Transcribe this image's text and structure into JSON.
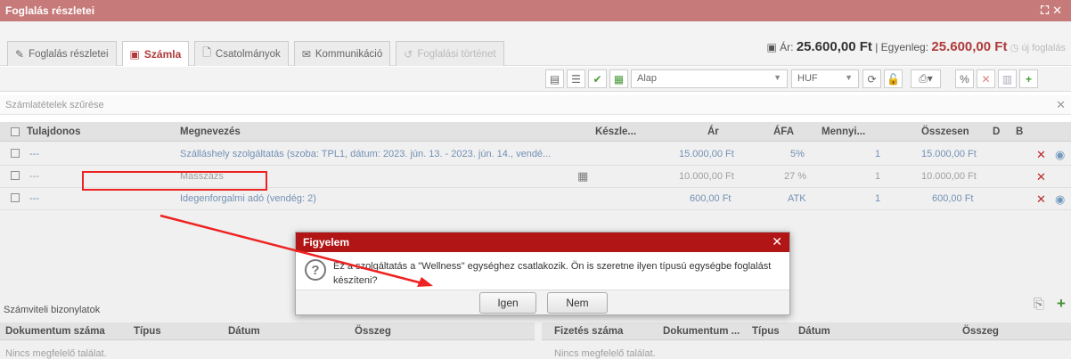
{
  "window": {
    "title": "Foglalás részletei"
  },
  "tabs": [
    {
      "label": "Foglalás részletei",
      "icon": "pencil-icon"
    },
    {
      "label": "Számla",
      "icon": "invoice-icon"
    },
    {
      "label": "Csatolmányok",
      "icon": "file-icon"
    },
    {
      "label": "Kommunikáció",
      "icon": "envelope-icon"
    },
    {
      "label": "Foglalási történet",
      "icon": "history-icon"
    }
  ],
  "price_info": {
    "price_label": "Ár:",
    "price": "25.600,00 Ft",
    "balance_label": "| Egyenleg:",
    "balance": "25.600,00 Ft",
    "new_booking": "új foglalás"
  },
  "toolbar": {
    "template": "Alap",
    "currency": "HUF"
  },
  "filter": {
    "placeholder": "Számlatételek szűrése"
  },
  "table": {
    "columns": [
      "Tulajdonos",
      "Megnevezés",
      "Készle...",
      "Ár",
      "ÁFA",
      "Mennyi...",
      "Összesen",
      "D",
      "B"
    ],
    "rows": [
      {
        "owner": "---",
        "name": "Szálláshely szolgáltatás (szoba: TPL1, dátum: 2023. jún. 13. - 2023. jún. 14., vendé...",
        "price": "15.000,00 Ft",
        "vat": "5%",
        "qty": "1",
        "total": "15.000,00 Ft"
      },
      {
        "owner": "---",
        "name": "Masszázs",
        "price": "10.000,00 Ft",
        "vat": "27 %",
        "qty": "1",
        "total": "10.000,00 Ft"
      },
      {
        "owner": "---",
        "name": "Idegenforgalmi adó (vendég: 2)",
        "price": "600,00 Ft",
        "vat": "ATK",
        "qty": "1",
        "total": "600,00 Ft"
      }
    ]
  },
  "accounting": {
    "title": "Számviteli bizonylatok",
    "left_columns": [
      "Dokumentum száma",
      "Típus",
      "Dátum",
      "Összeg"
    ],
    "right_columns": [
      "Fizetés száma",
      "Dokumentum ...",
      "Típus",
      "Dátum",
      "Összeg"
    ],
    "no_result": "Nincs megfelelő találat."
  },
  "dialog": {
    "title": "Figyelem",
    "message": "Ez a szolgáltatás a \"Wellness\" egységhez csatlakozik. Ön is szeretne ilyen típusú egységbe foglalást készíteni?",
    "yes": "Igen",
    "no": "Nem"
  },
  "colors": {
    "titlebar": "#c77a7a",
    "dialog_header": "#b21515",
    "accent": "#b03a3a",
    "annotation": "#ee2222"
  }
}
